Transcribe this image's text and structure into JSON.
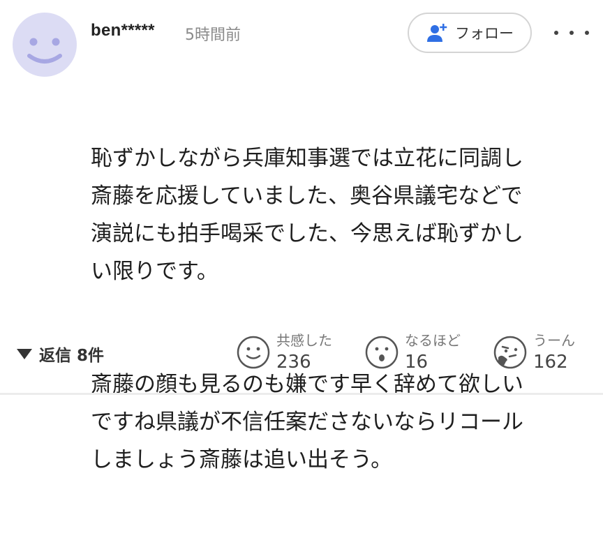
{
  "comment": {
    "username": "ben*****",
    "time": "5時間前",
    "follow_label": "フォロー",
    "paragraphs": [
      "恥ずかしながら兵庫知事選では立花に同調し\n斎藤を応援していました、奥谷県議宅などで\n演説にも拍手喝采でした、今思えば恥ずかし\nい限りです。",
      "斎藤の顔も見るのも嫌です早く辞めて欲しい\nですね県議が不信任案ださないならリコール\nしましょう斎藤は追い出そう。"
    ]
  },
  "footer": {
    "replies_label": "返信 8件",
    "reactions": [
      {
        "label": "共感した",
        "count": "236",
        "icon": "smile-face-icon"
      },
      {
        "label": "なるほど",
        "count": "16",
        "icon": "surprised-face-icon"
      },
      {
        "label": "うーん",
        "count": "162",
        "icon": "thinking-face-icon"
      }
    ]
  },
  "colors": {
    "avatar_bg": "#dcdcf4",
    "avatar_face": "#a7a7e3",
    "follow_icon": "#2f6fe4",
    "muted": "#8a8a8a"
  }
}
